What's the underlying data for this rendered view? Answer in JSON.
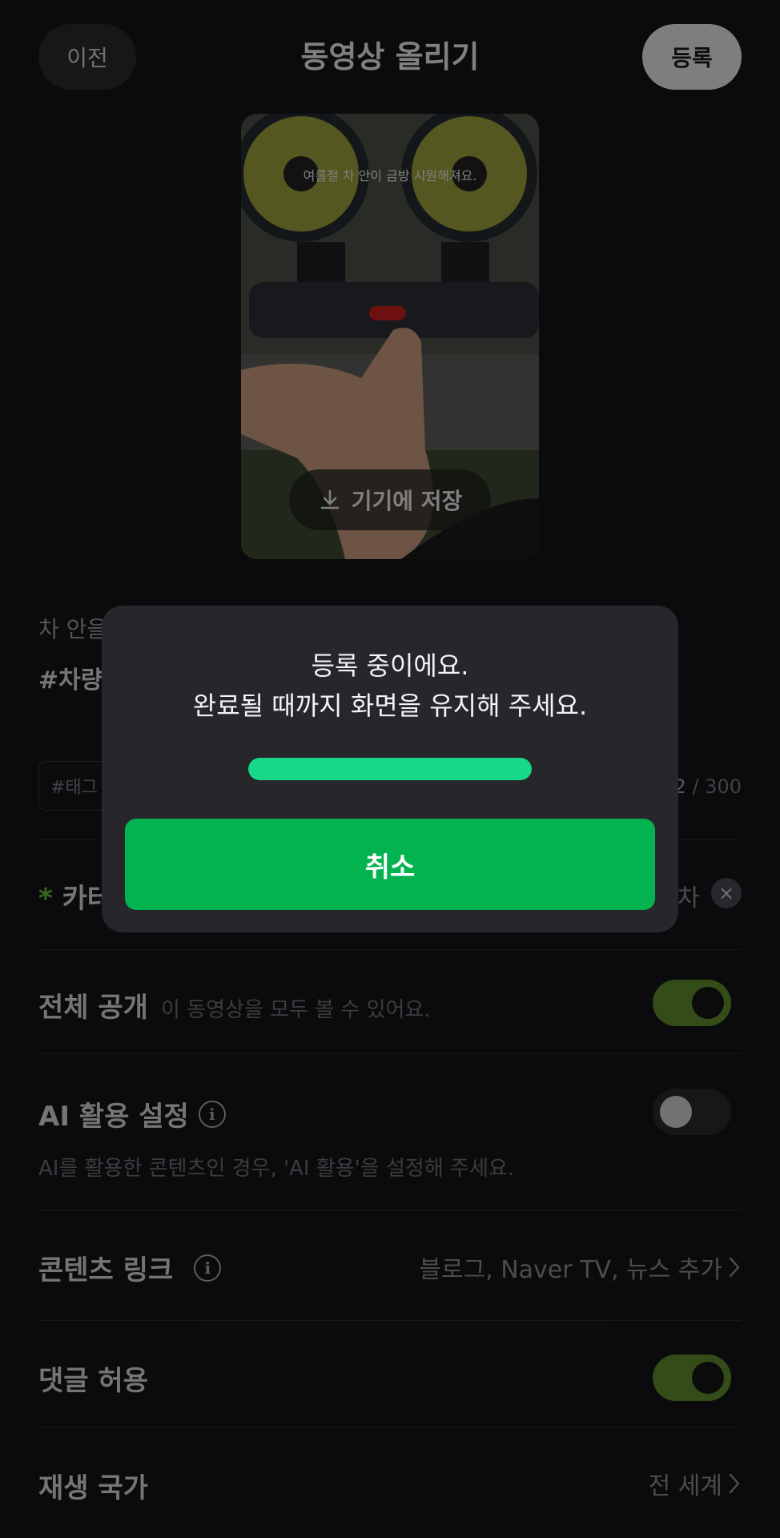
{
  "header": {
    "prev_label": "이전",
    "title": "동영상 올리기",
    "register_label": "등록"
  },
  "video": {
    "caption": "여름철 차 안이 금방 시원해져요.",
    "save_label": "기기에 저장"
  },
  "description": {
    "text_partial": "차 안을",
    "hashtags_partial": "#차량"
  },
  "tags": {
    "placeholder_partial": "#태그",
    "count": "2",
    "max": "/ 300"
  },
  "category": {
    "required_mark": "*",
    "label_partial": "카테",
    "value_partial": "차"
  },
  "public": {
    "label": "전체 공개",
    "sub": "이 동영상을 모두 볼 수 있어요.",
    "enabled": true
  },
  "ai": {
    "label": "AI 활용 설정",
    "hint": "AI를 활용한 콘텐츠인 경우, 'AI 활용'을 설정해 주세요.",
    "enabled": false
  },
  "content_link": {
    "label": "콘텐츠 링크",
    "value": "블로그, Naver TV, 뉴스 추가"
  },
  "comments": {
    "label": "댓글 허용",
    "enabled": true
  },
  "country": {
    "label": "재생 국가",
    "value": "전 세계"
  },
  "modal": {
    "line1": "등록 중이에요.",
    "line2": "완료될 때까지 화면을 유지해 주세요.",
    "progress_percent": 100,
    "cancel_label": "취소"
  },
  "colors": {
    "accent_green": "#02b350",
    "progress": "#18d98a",
    "toggle_on": "#5d8a2c"
  }
}
